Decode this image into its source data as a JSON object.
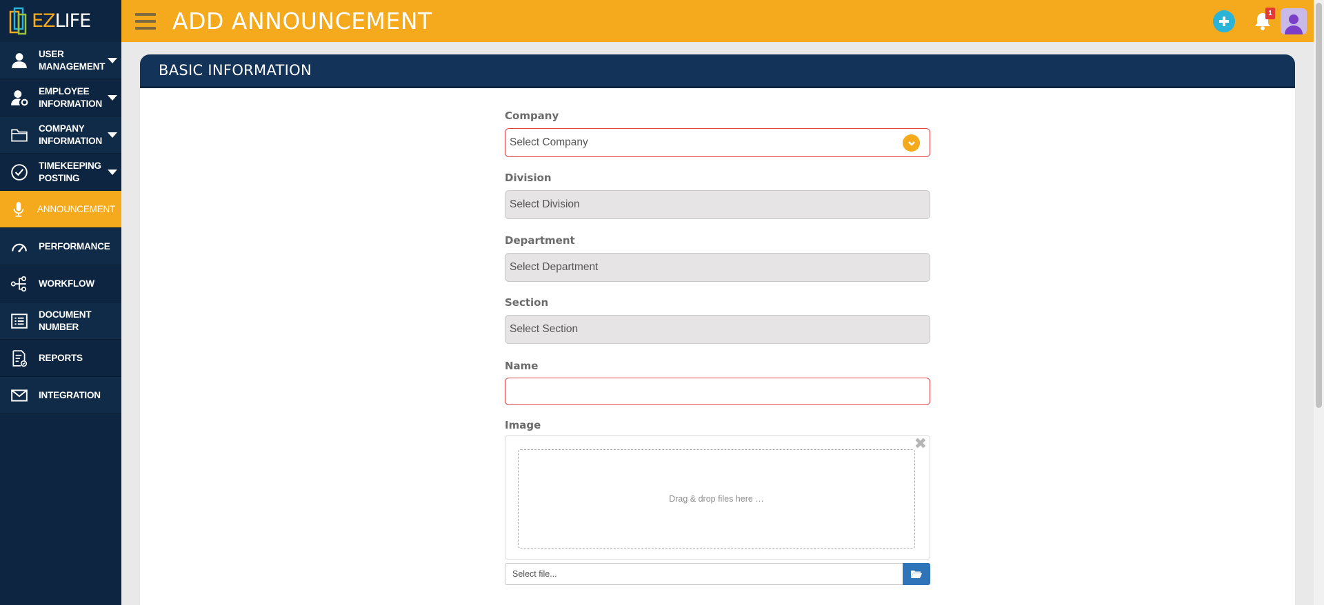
{
  "app": {
    "logo_ez": "EZ",
    "logo_life": "LIFE"
  },
  "header": {
    "title": "ADD ANNOUNCEMENT",
    "notification_count": "1"
  },
  "sidebar": {
    "items": [
      {
        "label": "USER MANAGEMENT",
        "icon": "user-icon",
        "has_submenu": true
      },
      {
        "label": "EMPLOYEE INFORMATION",
        "icon": "user-gear-icon",
        "has_submenu": true
      },
      {
        "label": "COMPANY INFORMATION",
        "icon": "folder-icon",
        "has_submenu": true
      },
      {
        "label": "TIMEKEEPING POSTING",
        "icon": "check-circle-icon",
        "has_submenu": true
      },
      {
        "label": "ANNOUNCEMENT",
        "icon": "microphone-icon",
        "has_submenu": false,
        "active": true
      },
      {
        "label": "PERFORMANCE",
        "icon": "gauge-icon",
        "has_submenu": false
      },
      {
        "label": "WORKFLOW",
        "icon": "workflow-icon",
        "has_submenu": false
      },
      {
        "label": "DOCUMENT NUMBER",
        "icon": "list-icon",
        "has_submenu": false
      },
      {
        "label": "REPORTS",
        "icon": "report-icon",
        "has_submenu": false
      },
      {
        "label": "INTEGRATION",
        "icon": "envelope-icon",
        "has_submenu": false
      }
    ]
  },
  "card": {
    "title": "BASIC INFORMATION"
  },
  "form": {
    "company": {
      "label": "Company",
      "placeholder": "Select Company"
    },
    "division": {
      "label": "Division",
      "placeholder": "Select Division"
    },
    "department": {
      "label": "Department",
      "placeholder": "Select Department"
    },
    "section": {
      "label": "Section",
      "placeholder": "Select Section"
    },
    "name": {
      "label": "Name",
      "value": ""
    },
    "image": {
      "label": "Image",
      "dropzone_text": "Drag & drop files here …",
      "file_placeholder": "Select file..."
    }
  },
  "colors": {
    "accent": "#f5a91c",
    "sidebar": "#0d2540",
    "card_header": "#133359",
    "required_border": "#e04444",
    "plus": "#2bb3d8",
    "file_button": "#2f74b8"
  }
}
